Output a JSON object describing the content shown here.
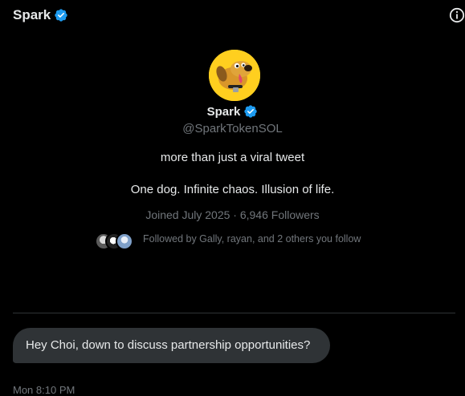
{
  "header": {
    "name": "Spark"
  },
  "profile": {
    "name": "Spark",
    "handle": "@SparkTokenSOL",
    "bio_line1": "more than just a viral tweet",
    "bio_line2": "One dog. Infinite chaos. Illusion of life.",
    "joined": "Joined July 2025",
    "separator": "·",
    "followers": "6,946 Followers",
    "followed_by": "Followed by Gally, rayan, and 2 others you follow"
  },
  "messages": [
    {
      "text": "Hey Choi, down to discuss partnership opportunities?",
      "time": "Mon 8:10 PM"
    }
  ],
  "colors": {
    "background": "#000000",
    "text_primary": "#e7e9ea",
    "text_secondary": "#71767b",
    "verified_blue": "#1d9bf0",
    "bubble": "#2f3336",
    "avatar_yellow": "#ffcf1f"
  },
  "icons": {
    "verified": "verified-badge-icon",
    "info": "info-icon"
  }
}
